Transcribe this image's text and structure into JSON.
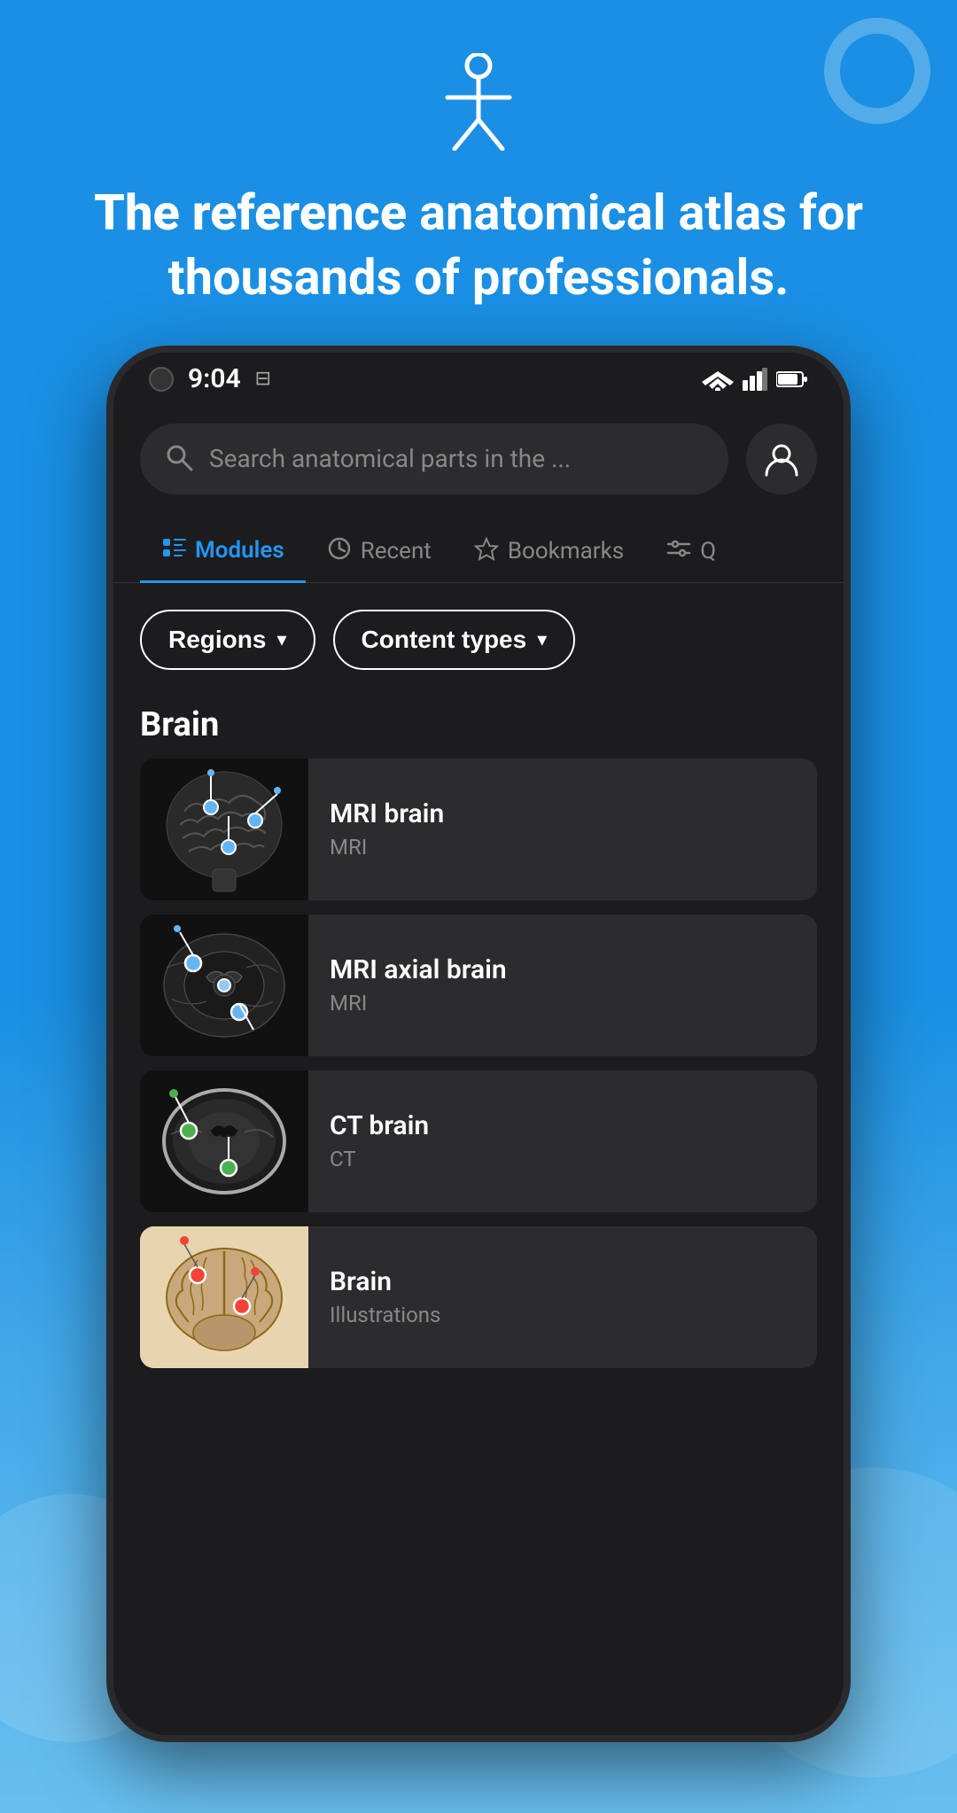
{
  "meta": {
    "status_time": "9:04",
    "status_icon": "⊟"
  },
  "hero": {
    "title_bold": "The reference",
    "title_rest": " anatomical atlas for thousands of professionals.",
    "icon_alt": "human-figure-icon"
  },
  "search": {
    "placeholder": "Search anatomical parts in the ...",
    "avatar_label": "User profile"
  },
  "tabs": [
    {
      "id": "modules",
      "label": "Modules",
      "icon": "modules",
      "active": true
    },
    {
      "id": "recent",
      "label": "Recent",
      "icon": "clock",
      "active": false
    },
    {
      "id": "bookmarks",
      "label": "Bookmarks",
      "icon": "star",
      "active": false
    },
    {
      "id": "search2",
      "label": "Q",
      "icon": "filter",
      "active": false
    }
  ],
  "filters": [
    {
      "id": "regions",
      "label": "Regions"
    },
    {
      "id": "content_types",
      "label": "Content types"
    }
  ],
  "sections": [
    {
      "title": "Brain",
      "modules": [
        {
          "id": "mri-brain",
          "title": "MRI brain",
          "subtitle": "MRI",
          "thumb_type": "mri-sagittal"
        },
        {
          "id": "mri-axial-brain",
          "title": "MRI axial brain",
          "subtitle": "MRI",
          "thumb_type": "mri-axial"
        },
        {
          "id": "ct-brain",
          "title": "CT brain",
          "subtitle": "CT",
          "thumb_type": "ct-brain"
        },
        {
          "id": "brain-illus",
          "title": "Brain",
          "subtitle": "Illustrations",
          "thumb_type": "brain-illustration"
        }
      ]
    }
  ]
}
